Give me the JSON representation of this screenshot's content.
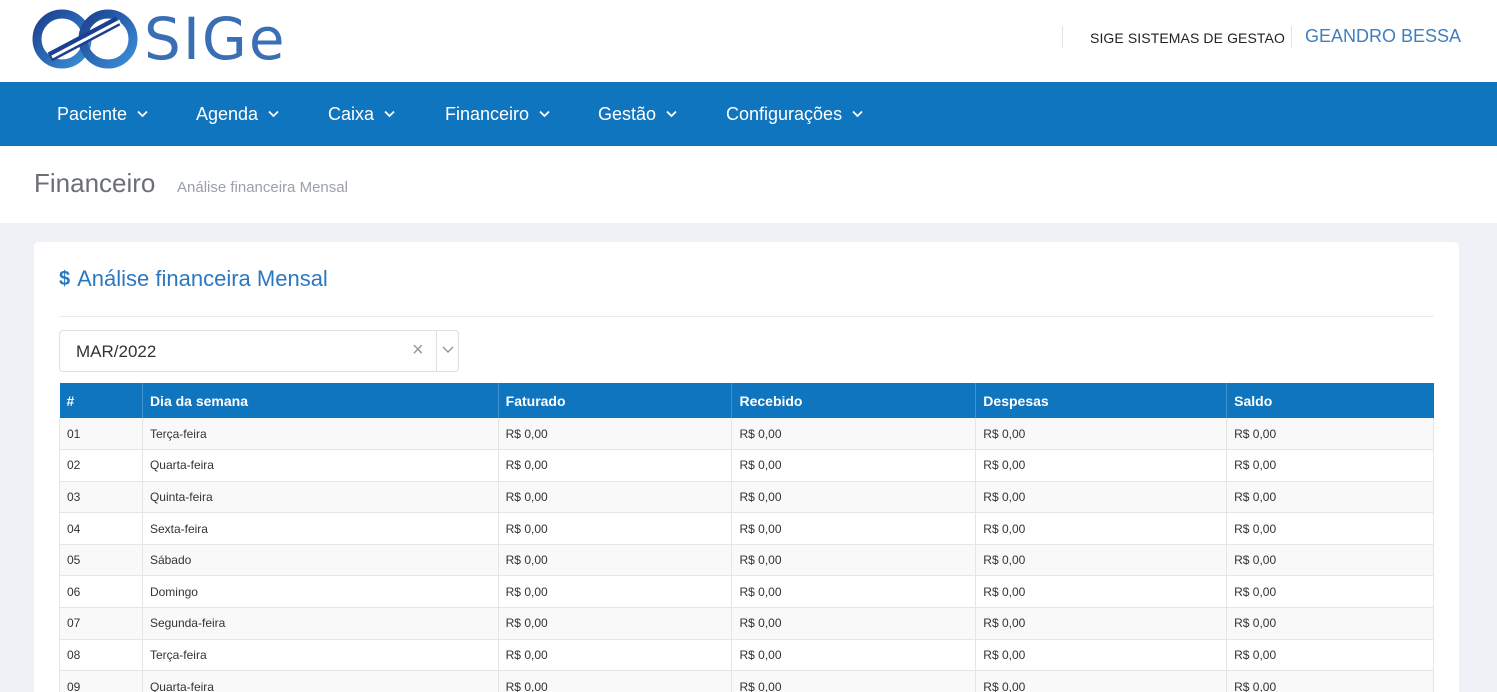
{
  "header": {
    "logo_text": "SIGe",
    "company": "SIGE SISTEMAS DE GESTAO",
    "user": "GEANDRO BESSA"
  },
  "nav": {
    "items": [
      {
        "label": "Paciente"
      },
      {
        "label": "Agenda"
      },
      {
        "label": "Caixa"
      },
      {
        "label": "Financeiro"
      },
      {
        "label": "Gestão"
      },
      {
        "label": "Configurações"
      }
    ]
  },
  "page": {
    "title": "Financeiro",
    "subtitle": "Análise financeira Mensal"
  },
  "portlet": {
    "icon": "$",
    "title": "Análise financeira Mensal",
    "month_select": {
      "value": "MAR/2022",
      "clear_symbol": "×"
    }
  },
  "table": {
    "headers": [
      "#",
      "Dia da semana",
      "Faturado",
      "Recebido",
      "Despesas",
      "Saldo"
    ],
    "rows": [
      [
        "01",
        "Terça-feira",
        "R$ 0,00",
        "R$ 0,00",
        "R$ 0,00",
        "R$ 0,00"
      ],
      [
        "02",
        "Quarta-feira",
        "R$ 0,00",
        "R$ 0,00",
        "R$ 0,00",
        "R$ 0,00"
      ],
      [
        "03",
        "Quinta-feira",
        "R$ 0,00",
        "R$ 0,00",
        "R$ 0,00",
        "R$ 0,00"
      ],
      [
        "04",
        "Sexta-feira",
        "R$ 0,00",
        "R$ 0,00",
        "R$ 0,00",
        "R$ 0,00"
      ],
      [
        "05",
        "Sábado",
        "R$ 0,00",
        "R$ 0,00",
        "R$ 0,00",
        "R$ 0,00"
      ],
      [
        "06",
        "Domingo",
        "R$ 0,00",
        "R$ 0,00",
        "R$ 0,00",
        "R$ 0,00"
      ],
      [
        "07",
        "Segunda-feira",
        "R$ 0,00",
        "R$ 0,00",
        "R$ 0,00",
        "R$ 0,00"
      ],
      [
        "08",
        "Terça-feira",
        "R$ 0,00",
        "R$ 0,00",
        "R$ 0,00",
        "R$ 0,00"
      ],
      [
        "09",
        "Quarta-feira",
        "R$ 0,00",
        "R$ 0,00",
        "R$ 0,00",
        "R$ 0,00"
      ]
    ]
  },
  "colors": {
    "brand_blue": "#1075bf",
    "title_blue": "#2b78c2",
    "logo_blue": "#3a6fb5"
  }
}
